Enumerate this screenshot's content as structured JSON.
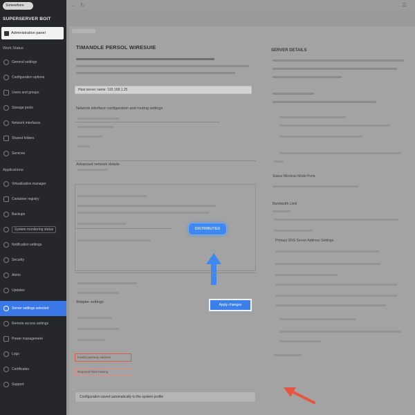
{
  "sidebar": {
    "search_label": "Somewhere",
    "brand": "SUPERSERVER BOIT",
    "active_top": "Administration panel",
    "section_label": "Work Status",
    "items": [
      {
        "label": "General settings",
        "icon": "gear-icon"
      },
      {
        "label": "Configuration options",
        "icon": "sliders-icon"
      },
      {
        "label": "Users and groups",
        "icon": "users-icon"
      },
      {
        "label": "Storage pools",
        "icon": "database-icon"
      },
      {
        "label": "Network interfaces",
        "icon": "network-icon"
      },
      {
        "label": "Shared folders",
        "icon": "folder-icon"
      },
      {
        "label": "Services",
        "icon": "service-icon"
      }
    ],
    "section2_label": "Applications",
    "items2": [
      {
        "label": "Virtualization manager",
        "icon": "vm-icon"
      },
      {
        "label": "Container registry",
        "icon": "container-icon"
      },
      {
        "label": "Backups",
        "icon": "backup-icon"
      },
      {
        "label": "System monitoring status",
        "icon": "monitor-icon"
      },
      {
        "label": "Notification settings",
        "icon": "bell-icon"
      },
      {
        "label": "Security",
        "icon": "shield-icon"
      },
      {
        "label": "Alerts",
        "icon": "alert-icon"
      },
      {
        "label": "Updates",
        "icon": "update-icon"
      }
    ],
    "highlight_item": "Server settings selected",
    "items3": [
      {
        "label": "Remote access settings",
        "icon": "remote-icon"
      },
      {
        "label": "Power management",
        "icon": "power-icon"
      },
      {
        "label": "Logs",
        "icon": "logs-icon"
      },
      {
        "label": "Certificates",
        "icon": "certificate-icon"
      },
      {
        "label": "Support",
        "icon": "support-icon"
      }
    ]
  },
  "topbar": {
    "icons": [
      "back-icon",
      "refresh-icon",
      "menu-icon"
    ]
  },
  "main": {
    "title": "TIMANDLE PERSOL WIRESUIE",
    "field_value": "Host server name: 192.168.1.25",
    "section1_heading": "Network interface configuration and routing settings",
    "section2_heading": "Advanced network details",
    "section3_heading": "Adapter settings",
    "badge_button": "DISTRIBUTED",
    "primary_button": "Apply changes",
    "error_field_1": "Invalid gateway address",
    "error_field_2": "Required field missing",
    "bottom_field": "Configuration saved automatically to the system profile"
  },
  "right": {
    "heading": "SERVER DETAILS",
    "label_1": "Status Wireless Mode Ports",
    "label_2": "Bandwidth Limit",
    "label_3": "Primary DNS Server Address Settings"
  },
  "colors": {
    "sidebar_bg": "#26272a",
    "accent": "#3b78e7",
    "error": "#e05b4c",
    "annotation_arrow": "#e8553f"
  }
}
